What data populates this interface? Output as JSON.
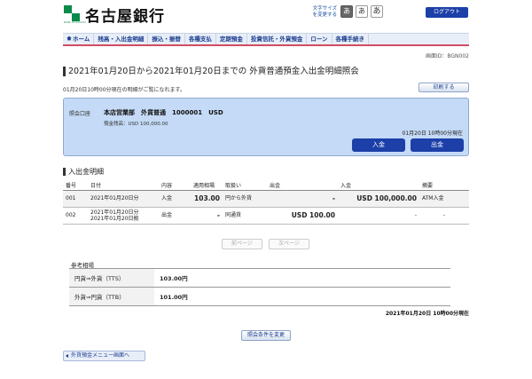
{
  "header": {
    "bank_name": "名古屋銀行",
    "logo_sub": "BANK OF NAGOYA",
    "font_size_label": "文字サイズを変更する",
    "font_buttons": [
      "あ",
      "あ",
      "あ"
    ],
    "logout": "ログアウト"
  },
  "nav": {
    "items": [
      "ホーム",
      "残高・入出金明細",
      "振込・振替",
      "各種支払",
      "定期預金",
      "投資信託・外貨預金",
      "ローン",
      "各種手続き"
    ]
  },
  "screen_id": "画面ID：BGN002",
  "page_title": "2021年01月20日から2021年01月20日までの 外貨普通預金入出金明細照会",
  "note": "01月20日10時00分現在の明細がご覧になれます。",
  "print_button": "印刷する",
  "account": {
    "label": "照会口座",
    "info": "本店営業部　外貨普通　1000001　USD",
    "balance": "預金残高：USD 100,000.00",
    "time": "01月20日 10時00分現在",
    "deposit_button": "入金",
    "withdraw_button": "出金"
  },
  "transactions": {
    "title": "入出金明細",
    "headers": [
      "番号",
      "日付",
      "内容",
      "適用相場",
      "取扱い",
      "出金",
      "入金",
      "摘要"
    ],
    "rows": [
      {
        "no": "001",
        "date1": "2021年01月20日分",
        "date2": "",
        "content": "入金",
        "rate": "103.00",
        "handling": "円から外貨",
        "out": "-",
        "in": "USD 100,000.00",
        "memo": "ATM入金"
      },
      {
        "no": "002",
        "date1": "2021年01月20日分",
        "date2": "2021年01月20日拠",
        "content": "出金",
        "rate": "-",
        "handling": "同通貨",
        "out": "USD 100.00",
        "in": "-",
        "memo": "-"
      }
    ]
  },
  "pager": {
    "prev": "前ページ",
    "next": "次ページ"
  },
  "reference": {
    "title": "参考相場",
    "rows": [
      {
        "label": "円貨⇒外貨（TTS）",
        "value": "103.00円"
      },
      {
        "label": "外貨⇒円貨（TTB）",
        "value": "101.00円"
      }
    ],
    "time": "2021年01月20日 10時00分現在"
  },
  "change_condition_button": "照会条件を変更",
  "back_link": "外貨預金メニュー画面へ",
  "colors": {
    "accent": "#1c3fa8",
    "brand": "#0b8a4a",
    "nav_border": "#d24d63",
    "account_bg": "#c4daf6"
  }
}
